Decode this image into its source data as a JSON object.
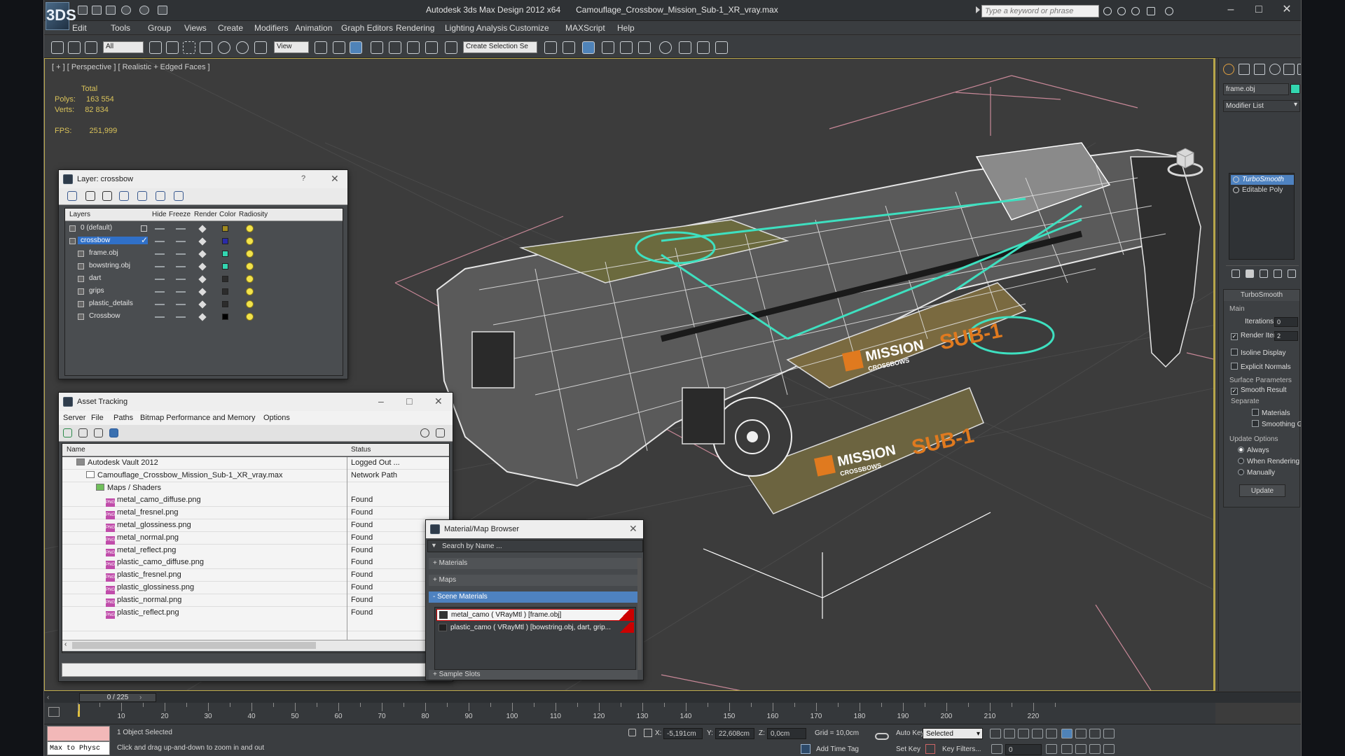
{
  "app": {
    "title": "Autodesk 3ds Max Design 2012 x64",
    "file": "Camouflage_Crossbow_Mission_Sub-1_XR_vray.max",
    "logo": "3DS",
    "search_placeholder": "Type a keyword or phrase"
  },
  "menu": [
    "Edit",
    "Tools",
    "Group",
    "Views",
    "Create",
    "Modifiers",
    "Animation",
    "Graph Editors",
    "Rendering",
    "Lighting Analysis",
    "Customize",
    "MAXScript",
    "Help"
  ],
  "toolbar": {
    "selection_filter": "All",
    "ref_coord": "View",
    "named_selection": "Create Selection Se"
  },
  "viewport": {
    "label": "[ + ] [ Perspective ] [ Realistic + Edged Faces ]",
    "stats": {
      "total_label": "Total",
      "polys_label": "Polys:",
      "polys": "163 554",
      "verts_label": "Verts:",
      "verts": "82 834",
      "fps_label": "FPS:",
      "fps": "251,999"
    },
    "decal_brand": "MISSION",
    "decal_sub": "CROSSBOWS",
    "decal_model": "SUB-1"
  },
  "command_panel": {
    "object_name": "frame.obj",
    "object_color": "#33d6b0",
    "modifier_list": "Modifier List",
    "stack": [
      {
        "name": "TurboSmooth",
        "selected": true
      },
      {
        "name": "Editable Poly",
        "selected": false
      }
    ],
    "rollout_title": "TurboSmooth",
    "main_label": "Main",
    "iterations_label": "Iterations:",
    "iterations": "0",
    "render_iters_label": "Render Iters:",
    "render_iters": "2",
    "isoline": "Isoline Display",
    "explicit": "Explicit Normals",
    "surface_params": "Surface Parameters",
    "smooth_result": "Smooth Result",
    "separate": "Separate",
    "materials": "Materials",
    "smoothing_groups": "Smoothing Groups",
    "update_options": "Update Options",
    "always": "Always",
    "when_rendering": "When Rendering",
    "manually": "Manually",
    "update_btn": "Update"
  },
  "layer_window": {
    "title": "Layer: crossbow",
    "help": "?",
    "columns": [
      "Layers",
      "Hide",
      "Freeze",
      "Render",
      "Color",
      "Radiosity"
    ],
    "rows": [
      {
        "name": "0 (default)",
        "indent": 0,
        "color": "#a08a20",
        "selected": false
      },
      {
        "name": "crossbow",
        "indent": 0,
        "color": "#2a2aa8",
        "selected": true
      },
      {
        "name": "frame.obj",
        "indent": 1,
        "color": "#33d6b0",
        "selected": false
      },
      {
        "name": "bowstring.obj",
        "indent": 1,
        "color": "#33d6b0",
        "selected": false
      },
      {
        "name": "dart",
        "indent": 1,
        "color": "#2c2c2c",
        "selected": false
      },
      {
        "name": "grips",
        "indent": 1,
        "color": "#2c2c2c",
        "selected": false
      },
      {
        "name": "plastic_details",
        "indent": 1,
        "color": "#2c2c2c",
        "selected": false
      },
      {
        "name": "Crossbow",
        "indent": 1,
        "color": "#000000",
        "selected": false
      }
    ]
  },
  "asset_window": {
    "title": "Asset Tracking",
    "menu": [
      "Server",
      "File",
      "Paths",
      "Bitmap Performance and Memory",
      "Options"
    ],
    "col_name": "Name",
    "col_status": "Status",
    "rows": [
      {
        "name": "Autodesk Vault 2012",
        "status": "Logged Out ...",
        "indent": 0,
        "type": "vault"
      },
      {
        "name": "Camouflage_Crossbow_Mission_Sub-1_XR_vray.max",
        "status": "Network Path",
        "indent": 1,
        "type": "max"
      },
      {
        "name": "Maps / Shaders",
        "status": "",
        "indent": 2,
        "type": "folder"
      },
      {
        "name": "metal_camo_diffuse.png",
        "status": "Found",
        "indent": 3,
        "type": "png"
      },
      {
        "name": "metal_fresnel.png",
        "status": "Found",
        "indent": 3,
        "type": "png"
      },
      {
        "name": "metal_glossiness.png",
        "status": "Found",
        "indent": 3,
        "type": "png"
      },
      {
        "name": "metal_normal.png",
        "status": "Found",
        "indent": 3,
        "type": "png"
      },
      {
        "name": "metal_reflect.png",
        "status": "Found",
        "indent": 3,
        "type": "png"
      },
      {
        "name": "plastic_camo_diffuse.png",
        "status": "Found",
        "indent": 3,
        "type": "png"
      },
      {
        "name": "plastic_fresnel.png",
        "status": "Found",
        "indent": 3,
        "type": "png"
      },
      {
        "name": "plastic_glossiness.png",
        "status": "Found",
        "indent": 3,
        "type": "png"
      },
      {
        "name": "plastic_normal.png",
        "status": "Found",
        "indent": 3,
        "type": "png"
      },
      {
        "name": "plastic_reflect.png",
        "status": "Found",
        "indent": 3,
        "type": "png"
      }
    ],
    "png_tag": "PNG"
  },
  "material_browser": {
    "title": "Material/Map Browser",
    "search": "Search by Name ...",
    "sections": [
      "+ Materials",
      "+ Maps",
      "- Scene Materials"
    ],
    "items": [
      "metal_camo  ( VRayMtl )  [frame.obj]",
      "plastic_camo  ( VRayMtl )  [bowstring.obj, dart, grip..."
    ],
    "sample_slots": "+ Sample Slots"
  },
  "timeline": {
    "frame": "0 / 225",
    "ticks": [
      "10",
      "20",
      "30",
      "40",
      "50",
      "60",
      "70",
      "80",
      "90",
      "100",
      "110",
      "120",
      "130",
      "140",
      "150",
      "160",
      "170",
      "180",
      "190",
      "200",
      "210",
      "220"
    ]
  },
  "statusbar": {
    "script": "Max to Physc",
    "selected": "1 Object Selected",
    "prompt": "Click and drag up-and-down to zoom in and out",
    "x_label": "X:",
    "x": "-5,191cm",
    "y_label": "Y:",
    "y": "22,608cm",
    "z_label": "Z:",
    "z": "0,0cm",
    "grid": "Grid = 10,0cm",
    "add_time_tag": "Add Time Tag",
    "auto_key": "Auto Key",
    "set_key": "Set Key",
    "key_mode": "Selected",
    "key_filters": "Key Filters...",
    "frame_field": "0"
  }
}
